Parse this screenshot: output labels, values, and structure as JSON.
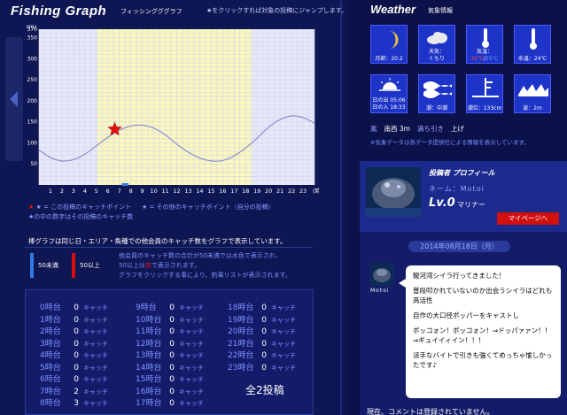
{
  "fishing_graph": {
    "title": "Fishing Graph",
    "subtitle": "フィッシングググラフ",
    "hint": "★をクリックすれば対象の投稿にジャンプします。",
    "unit_label": "(cm)",
    "hour_suffix": "(時)"
  },
  "chart_data": {
    "type": "line",
    "ylabel": "(cm)",
    "xlabel": "(時)",
    "ylim": [
      0,
      370
    ],
    "y_ticks": [
      50,
      100,
      150,
      200,
      250,
      300,
      350,
      370
    ],
    "x_ticks": [
      1,
      2,
      3,
      4,
      5,
      6,
      7,
      8,
      9,
      10,
      11,
      12,
      13,
      14,
      15,
      16,
      17,
      18,
      19,
      20,
      21,
      22,
      23
    ],
    "daylight_range": [
      5.1,
      18.55
    ],
    "tide_curve": {
      "x": [
        0,
        1,
        2,
        3,
        4,
        5,
        6,
        7,
        8,
        9,
        10,
        11,
        12,
        13,
        14,
        15,
        16,
        17,
        18,
        19,
        20,
        21,
        22,
        23,
        24
      ],
      "y": [
        83,
        65,
        57,
        60,
        73,
        93,
        113,
        130,
        140,
        142,
        135,
        119,
        97,
        78,
        64,
        57,
        58,
        69,
        88,
        111,
        137,
        155,
        164,
        160,
        147
      ]
    },
    "catch_points": [
      {
        "x": 6.6,
        "y": 132,
        "series": "この投稿のキャッチポイント"
      }
    ],
    "hour_markers": [
      {
        "hour": 7,
        "count": 2,
        "color": "#3a7ce0"
      }
    ]
  },
  "legend": {
    "item1": "★ = この投稿のキャッチポイント",
    "item2": "★ = その他のキャッチポイント（自分の投稿）",
    "item3": "★の中の数字はその投稿のキャッチ数"
  },
  "description": "棒グラフは同じ日・エリア・魚種での他会員のキャッチ数をグラフで表示しています。",
  "key": {
    "under50": "50未満",
    "over50": "50以上",
    "note_line1": "他会員のキャッチ数の合計が50未満では水色で表示され、",
    "note_line2_a": "50以上は",
    "note_line2_b": "赤",
    "note_line2_c": "で表示されます。",
    "note_line3": "グラフをクリックする事により、釣果リストが表示されます。"
  },
  "hour_stats": {
    "catch_label": "キャッチ",
    "col1": [
      {
        "hour": "0時台",
        "count": "0"
      },
      {
        "hour": "1時台",
        "count": "0"
      },
      {
        "hour": "2時台",
        "count": "0"
      },
      {
        "hour": "3時台",
        "count": "0"
      },
      {
        "hour": "4時台",
        "count": "0"
      },
      {
        "hour": "5時台",
        "count": "0"
      },
      {
        "hour": "6時台",
        "count": "0"
      },
      {
        "hour": "7時台",
        "count": "2"
      },
      {
        "hour": "8時台",
        "count": "3"
      }
    ],
    "col2": [
      {
        "hour": "9時台",
        "count": "0"
      },
      {
        "hour": "10時台",
        "count": "0"
      },
      {
        "hour": "11時台",
        "count": "0"
      },
      {
        "hour": "12時台",
        "count": "0"
      },
      {
        "hour": "13時台",
        "count": "0"
      },
      {
        "hour": "14時台",
        "count": "0"
      },
      {
        "hour": "15時台",
        "count": "0"
      },
      {
        "hour": "16時台",
        "count": "0"
      },
      {
        "hour": "17時台",
        "count": "0"
      }
    ],
    "col3": [
      {
        "hour": "18時台",
        "count": "0"
      },
      {
        "hour": "19時台",
        "count": "0"
      },
      {
        "hour": "20時台",
        "count": "0"
      },
      {
        "hour": "21時台",
        "count": "0"
      },
      {
        "hour": "22時台",
        "count": "0"
      },
      {
        "hour": "23時台",
        "count": "0"
      }
    ],
    "total": "全2投稿"
  },
  "weather": {
    "title": "Weather",
    "subtitle": "気象情報",
    "moon": {
      "label": "月齢：20.2",
      "icon": "moon-icon"
    },
    "sky": {
      "label_1": "天気：",
      "label_2": "くもり",
      "icon": "cloud-icon"
    },
    "air_temp": {
      "label_1": "気温：",
      "max": "31℃",
      "sep": "/",
      "min": "25℃",
      "icon": "thermometer-icon"
    },
    "water_temp": {
      "label": "水温：24℃",
      "icon": "thermometer-icon"
    },
    "sun": {
      "rise": "日の出 05:06",
      "set": "日の入 18:33",
      "icon": "sunrise-icon"
    },
    "tide": {
      "label": "潮：中潮",
      "icon": "tide-icon"
    },
    "tide_level": {
      "label": "潮位：133cm",
      "icon": "tide-level-icon"
    },
    "wave": {
      "label": "波：2m",
      "icon": "wave-icon"
    },
    "wind_label": "風",
    "wind_value": "南西 3m",
    "flow_label": "満ち引き",
    "flow_value": "上げ",
    "note": "※気象データは各データ提供社による情報を表示しています。"
  },
  "profile": {
    "title": "投稿者 プロフィール",
    "name_label": "ネーム：Motoi",
    "level": "Lv.0",
    "rank": "マリナー",
    "mypage_button": "マイページへ",
    "date": "2014年08月18日（月）",
    "avatar_name": "Motoi",
    "comment_lines": [
      "駿河湾シイラ行ってきました！",
      "普段叩かれていないのか出会うシイラはどれも高活性",
      "自作の大口径ポッパーをキャストし",
      "ボッコォン！ボッコォン！⇒ドッパァァン！！⇒ギュイイィイン！！！",
      "派手なバイトで引きも強くてめっちゃ愉しかったです♪"
    ],
    "no_comment": "現在、コメントは登録されていません。"
  }
}
